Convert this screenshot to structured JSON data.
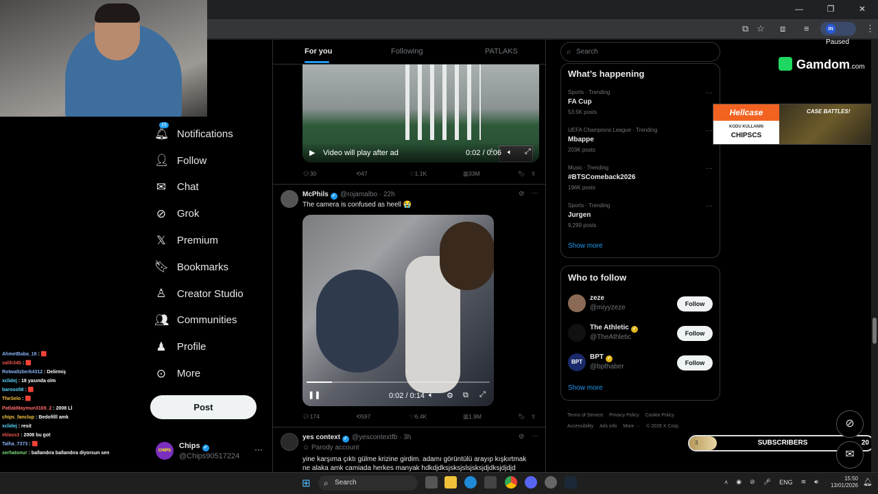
{
  "browser": {
    "paused_label": "Paused",
    "profile_initial": "m"
  },
  "sidebar": {
    "items": [
      {
        "label": "Notifications",
        "icon": "bell-icon",
        "badge": "15"
      },
      {
        "label": "Follow",
        "icon": "add-person-icon"
      },
      {
        "label": "Chat",
        "icon": "mail-icon"
      },
      {
        "label": "Grok",
        "icon": "grok-icon"
      },
      {
        "label": "Premium",
        "icon": "x-logo-icon"
      },
      {
        "label": "Bookmarks",
        "icon": "bookmark-icon"
      },
      {
        "label": "Creator Studio",
        "icon": "creator-studio-icon"
      },
      {
        "label": "Communities",
        "icon": "communities-icon"
      },
      {
        "label": "Profile",
        "icon": "person-icon"
      },
      {
        "label": "More",
        "icon": "more-circle-icon"
      }
    ],
    "post_label": "Post",
    "account": {
      "name": "Chips",
      "handle": "@Chips90517224",
      "avatar_text": "CHIPS"
    }
  },
  "chat": [
    {
      "user": "AhmetBaba_16",
      "color": "#8ab4f8",
      "msg": ""
    },
    {
      "user": "salih34b",
      "color": "#e8554e",
      "msg": ""
    },
    {
      "user": "Rotwaltzberk4312",
      "color": "#8ab4f8",
      "msg": "Delirmiş"
    },
    {
      "user": "xclidej",
      "color": "#5bd6ff",
      "msg": "18 yasında olm"
    },
    {
      "user": "barooo58",
      "color": "#5bd6ff",
      "msg": ""
    },
    {
      "user": "TheSelo",
      "color": "#f5c542",
      "msg": ""
    },
    {
      "user": "PatlakMaymun3169_2",
      "color": "#ff6b6b",
      "msg": "2008 Lİ"
    },
    {
      "user": "chips_fanclup",
      "color": "#f5c542",
      "msg": "Bedofilll amk"
    },
    {
      "user": "xclidej",
      "color": "#5bd6ff",
      "msg": "resit"
    },
    {
      "user": "eklass3",
      "color": "#e8554e",
      "msg": "2008 bu got"
    },
    {
      "user": "Talha_7373",
      "color": "#8ab4f8",
      "msg": ""
    },
    {
      "user": "serhatonur",
      "color": "#7ee081",
      "msg": "ballandıra ballandıra diyorsun sen"
    }
  ],
  "feed": {
    "tabs": [
      "For you",
      "Following",
      "PATLAKS"
    ],
    "tweet1": {
      "video_overlay": "Video will play after ad",
      "time": "0:02 / 0:06",
      "thumb_count": "4",
      "replies": "30",
      "reposts": "47",
      "likes": "1.1K",
      "views": "33M"
    },
    "tweet2": {
      "name": "McPhils",
      "handle": "@rojamalbo",
      "time": "22h",
      "text": "The camera is confused as heell 😭",
      "video_time": "0:02 / 0:14",
      "progress": 0.14,
      "replies": "174",
      "reposts": "597",
      "likes": "6.4K",
      "views": "1.9M"
    },
    "tweet3": {
      "name": "yes context",
      "handle": "@yescontextfb",
      "time": "3h",
      "label": "Parody account",
      "text": "yine karşıma çıktı gülme krizine girdim. adamı görüntülü arayıp kışkırtmak ne alaka amk camiada herkes manyak hdkdjdksjsksjslsjsksjdjdksjdjdjd"
    }
  },
  "right": {
    "search_placeholder": "Search",
    "trends_title": "What’s happening",
    "trends": [
      {
        "category": "Sports · Trending",
        "title": "FA Cup",
        "count": "53.5K posts"
      },
      {
        "category": "UEFA Champions League · Trending",
        "title": "Mbappe",
        "count": "203K posts"
      },
      {
        "category": "Music · Trending",
        "title": "#BTSComeback2026",
        "count": "196K posts"
      },
      {
        "category": "Sports · Trending",
        "title": "Jurgen",
        "count": "9,299 posts"
      }
    ],
    "show_more": "Show more",
    "wtf_title": "Who to follow",
    "who_to_follow": [
      {
        "name": "zeze",
        "handle": "@miyyzeze",
        "verified": false
      },
      {
        "name": "The Athletic",
        "handle": "@TheAthletic",
        "verified": true
      },
      {
        "name": "BPT",
        "handle": "@bpthaber",
        "verified": true,
        "avatar_text": "BPT"
      }
    ],
    "follow_label": "Follow",
    "footer": [
      "Terms of Service",
      "Privacy Policy",
      "Cookie Policy",
      "Accessibility",
      "Ads info",
      "More ···",
      "© 2026 X Corp."
    ]
  },
  "overlay": {
    "gamdom": "Gamdom",
    "gamdom_suffix": ".com",
    "hellcase": "Hellcase",
    "hellcase_kodu": "KODU KULLANIN",
    "hellcase_code": "CHIPSCS",
    "case_battles": "CASE BATTLES!",
    "subs_label": "SUBSCRIBERS",
    "subs_current": "3",
    "subs_goal": "20"
  },
  "taskbar": {
    "search": "Search",
    "lang": "ENG",
    "time": "15:50",
    "date": "13/01/2026"
  },
  "colors": {
    "accent": "#1d9bf0",
    "bg": "#000000",
    "border": "#2f3336"
  }
}
